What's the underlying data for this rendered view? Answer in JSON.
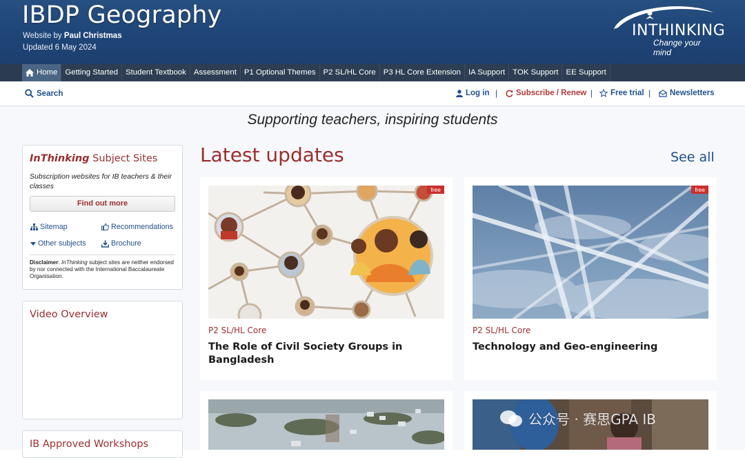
{
  "header": {
    "title": "IBDP Geography",
    "byline_prefix": "Website by ",
    "byline_author": "Paul Christmas",
    "updated": "Updated 6 May 2024",
    "logo_text": "INTHINKING",
    "logo_tagline": "Change your mind"
  },
  "nav": {
    "items": [
      {
        "label": "Home",
        "icon": "home-icon"
      },
      {
        "label": "Getting Started"
      },
      {
        "label": "Student Textbook"
      },
      {
        "label": "Assessment"
      },
      {
        "label": "P1 Optional Themes"
      },
      {
        "label": "P2 SL/HL Core"
      },
      {
        "label": "P3 HL Core Extension"
      },
      {
        "label": "IA Support"
      },
      {
        "label": "TOK Support"
      },
      {
        "label": "EE Support"
      }
    ]
  },
  "toolbar": {
    "search": "Search",
    "login": "Log in",
    "subscribe": "Subscribe / Renew",
    "free_trial": "Free trial",
    "newsletters": "Newsletters",
    "separator": "|"
  },
  "tagline": "Supporting teachers, inspiring students",
  "sidebar": {
    "subject_sites": {
      "title_italic": "InThinking",
      "title_rest": " Subject Sites",
      "subtitle": "Subscription websites for IB teachers & their classes",
      "button": "Find out more",
      "links": {
        "sitemap": "Sitemap",
        "recommendations": "Recommendations",
        "other_subjects": "Other subjects",
        "brochure": "Brochure"
      },
      "disclaimer_label": "Disclaimer",
      "disclaimer_italic": "InThinking",
      "disclaimer_text": " subject sites are neither endorsed by nor connected with the International Baccalaureate Organisation."
    },
    "video_title": "Video Overview",
    "workshops_title": "IB Approved Workshops"
  },
  "latest": {
    "title": "Latest updates",
    "see_all": "See all",
    "posts": [
      {
        "category": "P2 SL/HL Core",
        "title": "The Role of Civil Society Groups in Bangladesh",
        "badge": "free"
      },
      {
        "category": "P2 SL/HL Core",
        "title": "Technology and Geo-engineering",
        "badge": "free"
      }
    ]
  },
  "watermark": "公众号 · 赛思GPA IB",
  "colors": {
    "header_blue": "#1f4577",
    "nav_dark": "#2b3b50",
    "accent_red": "#9b2d2d",
    "link_blue": "#1f4f8c",
    "badge_red": "#c9302c"
  }
}
